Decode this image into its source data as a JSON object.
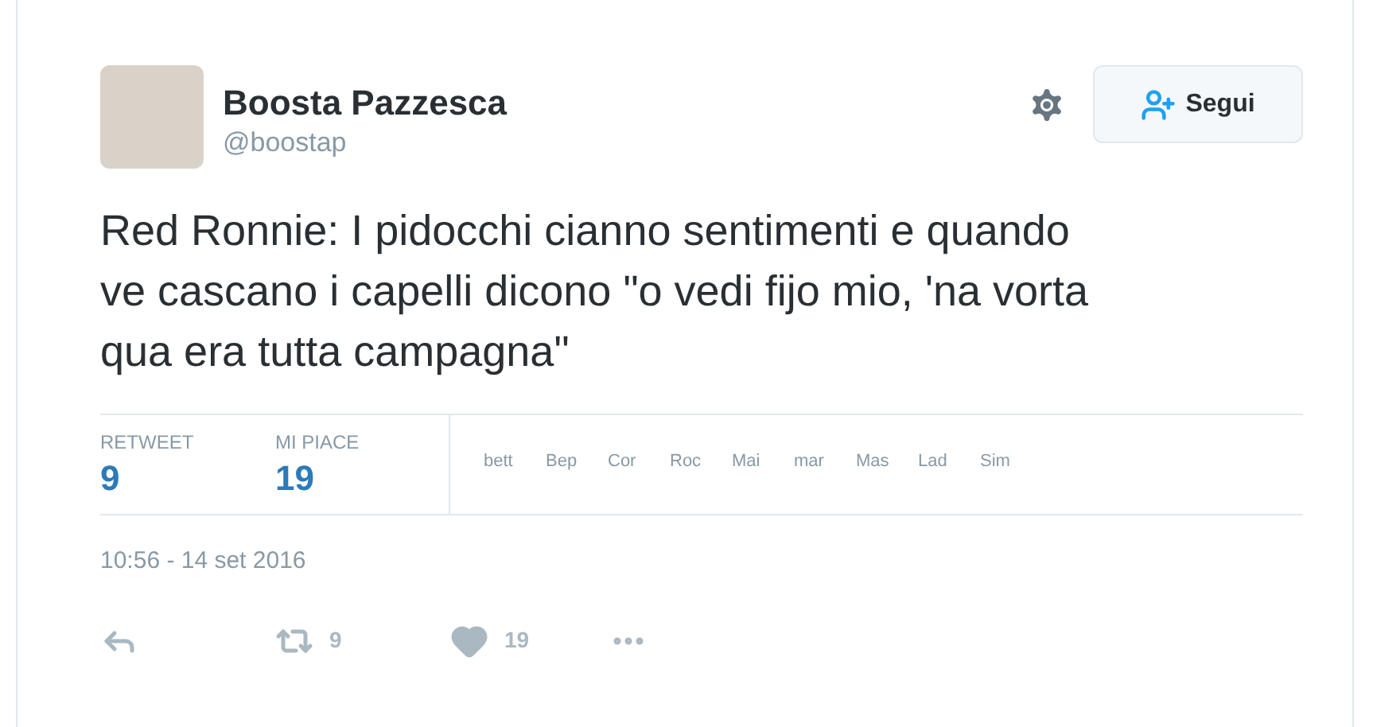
{
  "author": {
    "name": "Boosta Pazzesca",
    "handle": "@boostap"
  },
  "follow_button": {
    "label": "Segui"
  },
  "tweet_text": "Red Ronnie: I pidocchi cianno sentimenti e quando ve cascano i capelli dicono \"o vedi fijo mio, 'na vorta qua era tutta campagna\"",
  "stats": [
    {
      "label": "RETWEET",
      "value": "9"
    },
    {
      "label": "MI PIACE",
      "value": "19"
    }
  ],
  "likers": [
    "bett",
    "Bep",
    "Cor",
    "Roc",
    "Mai",
    "mar",
    "Mas",
    "Lad",
    "Sim"
  ],
  "timestamp": "10:56 - 14 set 2016",
  "actions": [
    {
      "kind": "reply"
    },
    {
      "kind": "retweet",
      "count": "9"
    },
    {
      "kind": "like",
      "count": "19"
    },
    {
      "kind": "more"
    }
  ]
}
